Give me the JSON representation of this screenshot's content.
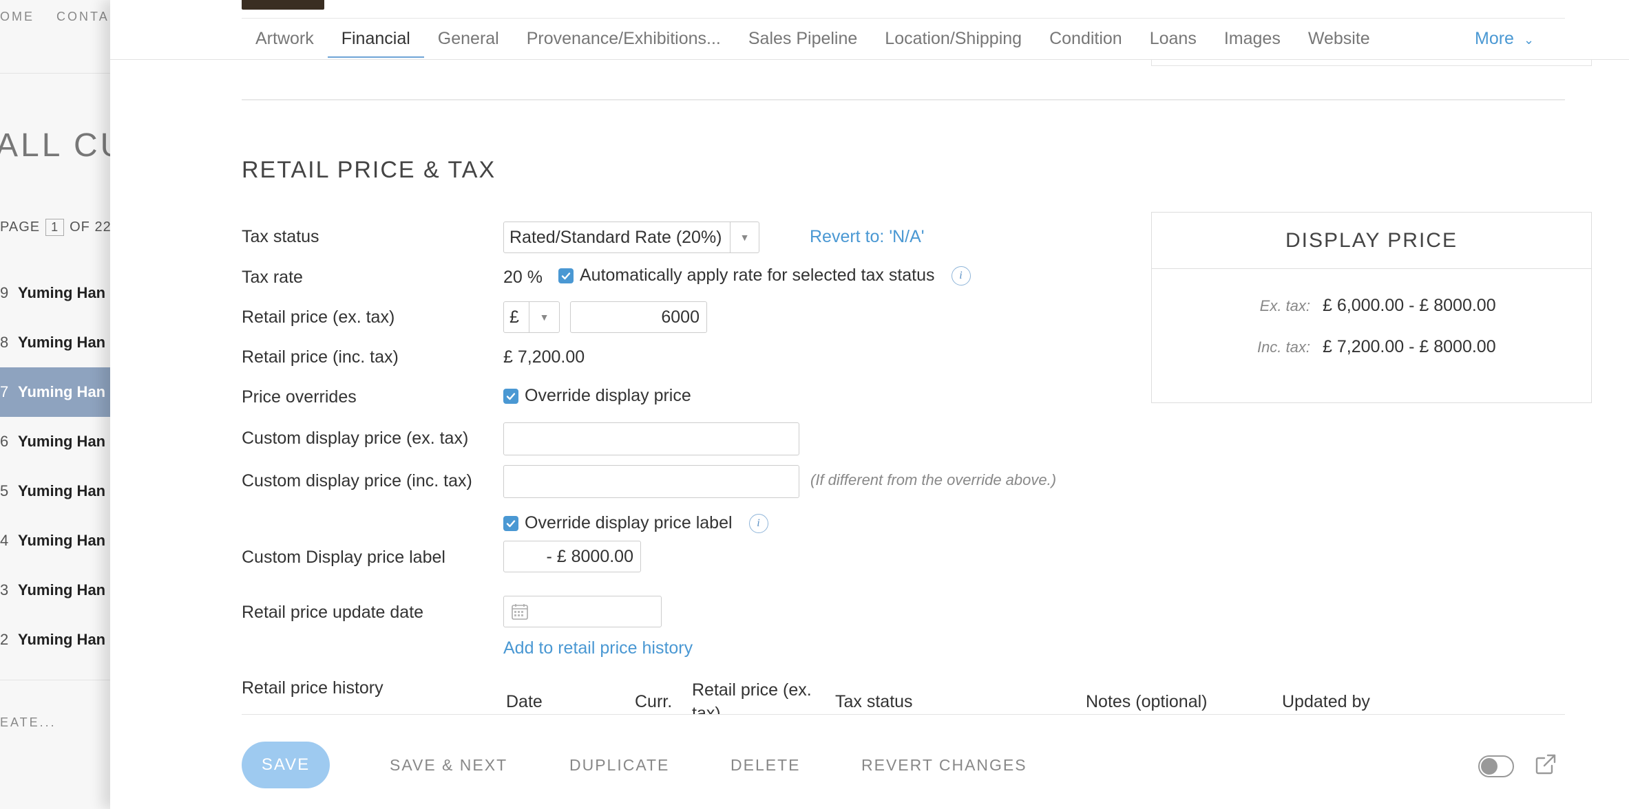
{
  "background": {
    "nav_items": [
      "OME",
      "CONTA"
    ],
    "title": "ALL CUR",
    "page_label": "PAGE",
    "page_number": "1",
    "page_of": "OF 22",
    "rows": [
      {
        "num": "9",
        "name": "Yuming Han",
        "selected": false
      },
      {
        "num": "8",
        "name": "Yuming Han",
        "selected": false
      },
      {
        "num": "7",
        "name": "Yuming Han",
        "selected": true
      },
      {
        "num": "6",
        "name": "Yuming Han",
        "selected": false
      },
      {
        "num": "5",
        "name": "Yuming Han",
        "selected": false
      },
      {
        "num": "4",
        "name": "Yuming Han",
        "selected": false
      },
      {
        "num": "3",
        "name": "Yuming Han",
        "selected": false
      },
      {
        "num": "2",
        "name": "Yuming Han",
        "selected": false
      }
    ],
    "create_label": "EATE..."
  },
  "tabs": {
    "items": [
      "Artwork",
      "Financial",
      "General",
      "Provenance/Exhibitions...",
      "Sales Pipeline",
      "Location/Shipping",
      "Condition",
      "Loans",
      "Images",
      "Website"
    ],
    "active": "Financial",
    "more": "More"
  },
  "section": {
    "title": "RETAIL PRICE & TAX"
  },
  "form": {
    "tax_status_label": "Tax status",
    "tax_status_value": "Rated/Standard Rate (20%)",
    "revert_link": "Revert to: 'N/A'",
    "tax_rate_label": "Tax rate",
    "tax_rate_value": "20 %",
    "auto_apply_label": "Automatically apply rate for selected tax status",
    "retail_ex_label": "Retail price (ex. tax)",
    "currency": "£",
    "retail_ex_value": "6000",
    "retail_inc_label": "Retail price (inc. tax)",
    "retail_inc_value": "£ 7,200.00",
    "price_overrides_label": "Price overrides",
    "override_display_label": "Override display price",
    "custom_ex_label": "Custom display price (ex. tax)",
    "custom_ex_value": "",
    "custom_inc_label": "Custom display price (inc. tax)",
    "custom_inc_value": "",
    "custom_inc_hint": "(If different from the override above.)",
    "override_label_label": "Override display price label",
    "custom_label_label": "Custom Display price label",
    "custom_label_value": "- £ 8000.00",
    "update_date_label": "Retail price update date",
    "update_date_value": "",
    "add_history_link": "Add to retail price history",
    "history_label": "Retail price history",
    "history_columns": [
      "Date",
      "Curr.",
      "Retail price (ex. tax)",
      "Tax status",
      "Notes (optional)",
      "Updated by"
    ]
  },
  "display_price": {
    "title": "DISPLAY PRICE",
    "ex_key": "Ex. tax:",
    "ex_value": "£ 6,000.00 - £ 8000.00",
    "inc_key": "Inc. tax:",
    "inc_value": "£ 7,200.00 - £ 8000.00"
  },
  "footer": {
    "save": "SAVE",
    "save_next": "SAVE & NEXT",
    "duplicate": "DUPLICATE",
    "delete": "DELETE",
    "revert": "REVERT CHANGES"
  },
  "colors": {
    "accent": "#4a98d3",
    "save_button": "#9ecaf0",
    "selected_row": "#8ea3bf"
  }
}
